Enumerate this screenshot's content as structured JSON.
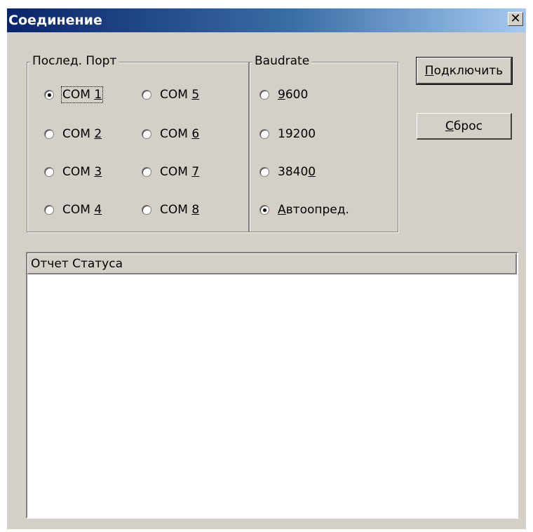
{
  "window": {
    "title": "Соединение",
    "close_label": "✕"
  },
  "port_group": {
    "label": "Послед. Порт",
    "options": [
      {
        "prefix": "COM ",
        "accel": "1",
        "checked": true
      },
      {
        "prefix": "COM ",
        "accel": "2",
        "checked": false
      },
      {
        "prefix": "COM ",
        "accel": "3",
        "checked": false
      },
      {
        "prefix": "COM ",
        "accel": "4",
        "checked": false
      },
      {
        "prefix": "COM ",
        "accel": "5",
        "checked": false
      },
      {
        "prefix": "COM ",
        "accel": "6",
        "checked": false
      },
      {
        "prefix": "COM ",
        "accel": "7",
        "checked": false
      },
      {
        "prefix": "COM ",
        "accel": "8",
        "checked": false
      }
    ]
  },
  "baud_group": {
    "label": "Baudrate",
    "options": [
      {
        "pre": "",
        "accel": "9",
        "post": "600",
        "checked": false
      },
      {
        "pre": "19200",
        "accel": "",
        "post": "",
        "checked": false
      },
      {
        "pre": "3840",
        "accel": "0",
        "post": "",
        "checked": false
      },
      {
        "pre": "",
        "accel": "А",
        "post": "втоопред.",
        "checked": true
      }
    ]
  },
  "buttons": {
    "connect": {
      "accel": "П",
      "rest": "одключить"
    },
    "reset": {
      "accel": "С",
      "rest": "брос"
    }
  },
  "status": {
    "header": "Отчет Статуса"
  }
}
